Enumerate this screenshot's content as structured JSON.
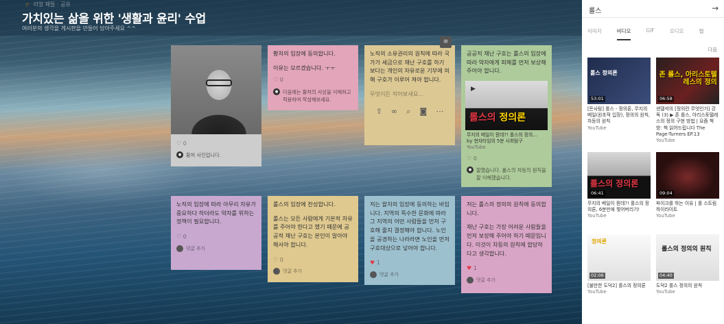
{
  "board": {
    "breadcrumb": "🎓 리얼 패들 · 공유",
    "title": "가치있는 삶을 위한 '생활과 윤리' 수업",
    "subtitle": "여러분의 생각을 게시판을 만들어 담아주세요 ^^",
    "menu_icon": "list-icon"
  },
  "cards": {
    "photo_card": {
      "likes": "0",
      "comment": "황처 사진입니다."
    },
    "pink_card": {
      "text": "황처의 입장에 동의합니다.",
      "sub": "이유는 모르겠습니다. ㅜㅜ",
      "likes": "0",
      "comment": "다음에는 황처의 사상을 이해하고 적용하여 작성해보세요."
    },
    "yellow_card": {
      "text": "노직의 소유권리의 원칙에 따라 국가가 세금으로 재난 구호를 하기 보다는 개인의 자유로운 기부에 의해 구호가 이루어 져야 합니다.",
      "placeholder": "무엇이든 적어보세요..."
    },
    "green_card": {
      "text": "공공적 재난 구호는 롤스의 입장에 따라 약자에게 피해를 먼저 보상해주어야 합니다.",
      "video_overlay": "롤스의",
      "video_overlay_highlight": " 정의론",
      "video_title": "무지의 베일이 뭔데?! 롤스의 정의...",
      "video_by": "by 현자타임의 5분 사회탐구",
      "video_source": "YouTube",
      "likes": "0",
      "comment": "잘했습니다. 롤스의 차등의 원칙을 잘 이해했습니다."
    },
    "purple_card": {
      "text": "노직의 입장에 따라 아무리 자유가 중요하다 하더라도 약자를 위하는 정책이 필요합니다.",
      "likes": "0",
      "comment_add": "댓글 추가"
    },
    "yellow2_card": {
      "text": "롤스의 입장에 찬성합니다.",
      "sub": "롤스는 모든 사람에게 기본적 자유를 주어야 한다고 했기 때문에 공공적 재난 구호는 본인이 알아야 해서야 합니다.",
      "likes": "0",
      "comment_add": "댓글 추가"
    },
    "blue_card": {
      "text": "저는 왈처의 입장에 동의하는 바입니다. 지역의 특수한 문화에 따라 그 지역의 어떤 사람들을 먼저 구호해 줄지 결정해야 합니다. 노인을 공경하는 나라라면 노인을 먼저 구호대상으로 넣어야 합니다.",
      "likes": "1",
      "comment_add": "댓글 추가"
    },
    "pink2_card": {
      "text": "저는 롤스의 정의의 원칙에 동의합니다.",
      "sub": "재난 구호는 가장 어려운 사람들을 먼저 보장해 주어야 하기 때문입니다. 이것이 차등의 원칙에 합당하다고 생각합니다.",
      "likes": "1",
      "comment_add": "댓글 추가"
    }
  },
  "panel": {
    "title": "롤스",
    "tabs": [
      "이미지",
      "비디오",
      "GIF",
      "오디오",
      "웹"
    ],
    "active_tab": "비디오",
    "more": "다음",
    "videos": [
      {
        "duration": "53:01",
        "caption": "[돈사탐] 롤스 - 정의론, 무지의 베일(원초적 입장), 정의의 원칙, 차등의 원칙",
        "source": "YouTube",
        "thumb_text": "롤스 정의론"
      },
      {
        "duration": "06:58",
        "caption": "샌델석의 [정의란 무엇인가] 강독 (3) ▶ 존 롤스, 아리스토텔레스의 정의 구현 방법 | 요즘 책방: 책 읽어드립니다 The Page-Turners EP.13",
        "source": "YouTube",
        "thumb_text": "존 롤스, 아리스토텔레스의 정의"
      },
      {
        "duration": "06:41",
        "caption": "무지의 베일이 뭔데?! 롤스의 정의론, 6분만에 찢어버리기!",
        "source": "YouTube",
        "thumb_text": "롤스의 정의론"
      },
      {
        "duration": "09:04",
        "caption": "파이크를 하는 이유 | 롤 스트림 하이라이트",
        "source": "YouTube",
        "thumb_text": ""
      },
      {
        "duration": "02:06",
        "caption": "[불만한 도덕2] 롤스의 정의론",
        "source": "YouTube",
        "thumb_text": "정의론"
      },
      {
        "duration": "04:40",
        "caption": "도덕2 롤스 정의의 원칙",
        "source": "YouTube",
        "thumb_text": "롤스의 정의의 원칙"
      }
    ]
  }
}
